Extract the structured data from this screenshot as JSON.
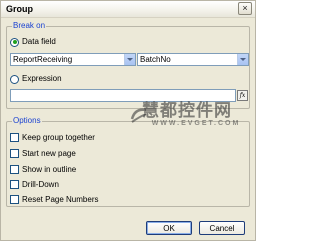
{
  "dialog": {
    "title": "Group",
    "close_glyph": "×"
  },
  "break_on": {
    "label": "Break on",
    "data_field": {
      "label": "Data field",
      "selected": true,
      "source_value": "ReportReceiving",
      "field_value": "BatchNo"
    },
    "expression": {
      "label": "Expression",
      "selected": false,
      "value": "",
      "button_glyph": "fx"
    }
  },
  "options": {
    "label": "Options",
    "items": [
      {
        "label": "Keep group together",
        "checked": false
      },
      {
        "label": "Start new page",
        "checked": false
      },
      {
        "label": "Show in outline",
        "checked": false
      },
      {
        "label": "Drill-Down",
        "checked": false
      },
      {
        "label": "Reset Page Numbers",
        "checked": false
      }
    ]
  },
  "buttons": {
    "ok": "OK",
    "cancel": "Cancel"
  },
  "watermark": {
    "main": "慧都控件网",
    "sub": "WWW.EVGET.COM"
  },
  "colors": {
    "group_label": "#1a42d1",
    "radio_dot": "#21a121",
    "input_border": "#7f9db9"
  }
}
